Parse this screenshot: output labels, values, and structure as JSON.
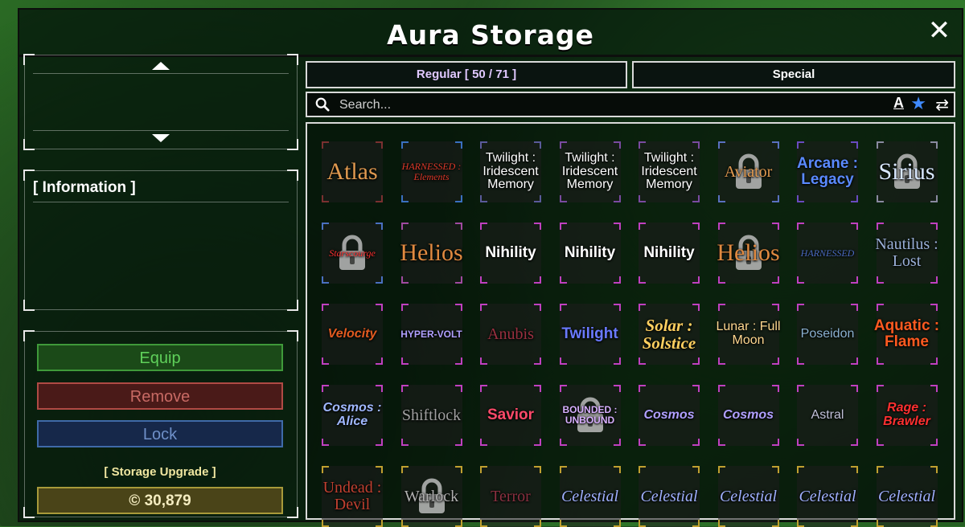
{
  "window": {
    "title": "Aura Storage",
    "close_label": "✕"
  },
  "info_panel": {
    "title": "[ Information ]"
  },
  "actions": {
    "equip": "Equip",
    "remove": "Remove",
    "lock": "Lock",
    "storage_upgrade_label": "[ Storage Upgrade ]",
    "upgrade_cost": "© 30,879"
  },
  "tabs": {
    "regular": "Regular [ 50 / 71 ]",
    "special": "Special"
  },
  "search": {
    "placeholder": "Search..."
  },
  "sort": {
    "alpha_label": "A",
    "favorite_icon": "star-icon",
    "swap_icon": "swap-arrows-icon"
  },
  "auras": [
    {
      "name": "Atlas",
      "locked": false,
      "color": "#e09a50",
      "border": "#7a3030",
      "style": "serif-big"
    },
    {
      "name": "HARNESSED : Elements",
      "locked": false,
      "color": "#e03a2a",
      "border": "#3a70c0",
      "style": "serif-small"
    },
    {
      "name": "Twilight : Iridescent Memory",
      "locked": false,
      "color": "#ffffff",
      "border": "#5a5a9a",
      "style": "sans"
    },
    {
      "name": "Twilight : Iridescent Memory",
      "locked": false,
      "color": "#ffffff",
      "border": "#7a4aa0",
      "style": "sans"
    },
    {
      "name": "Twilight : Iridescent Memory",
      "locked": false,
      "color": "#ffffff",
      "border": "#7a4aa0",
      "style": "sans"
    },
    {
      "name": "Aviator",
      "locked": true,
      "color": "#e09a50",
      "border": "#5a70c0",
      "style": "serif"
    },
    {
      "name": "Arcane : Legacy",
      "locked": false,
      "color": "#5a8aff",
      "border": "#6a4ac0",
      "style": "sans-bold"
    },
    {
      "name": "Sirius",
      "locked": true,
      "color": "#d8e8ff",
      "border": "#8a8aa0",
      "style": "serif-big"
    },
    {
      "name": "Starscourge",
      "locked": true,
      "color": "#ff3030",
      "border": "#4a70c0",
      "style": "serif-small"
    },
    {
      "name": "Helios",
      "locked": false,
      "color": "#e08a40",
      "border": "#a04aa0",
      "style": "serif-big"
    },
    {
      "name": "Nihility",
      "locked": false,
      "color": "#ffffff",
      "border": "#c040c0",
      "style": "sans-bold"
    },
    {
      "name": "Nihility",
      "locked": false,
      "color": "#ffffff",
      "border": "#c040c0",
      "style": "sans-bold"
    },
    {
      "name": "Nihility",
      "locked": false,
      "color": "#ffffff",
      "border": "#c040c0",
      "style": "sans-bold"
    },
    {
      "name": "Helios",
      "locked": true,
      "color": "#e08a40",
      "border": "#c040c0",
      "style": "serif-big"
    },
    {
      "name": "HARNESSED",
      "locked": false,
      "color": "#4a6ac0",
      "border": "#c040c0",
      "style": "serif-small"
    },
    {
      "name": "Nautilus : Lost",
      "locked": false,
      "color": "#9ab0d8",
      "border": "#c040c0",
      "style": "serif"
    },
    {
      "name": "Velocity",
      "locked": false,
      "color": "#e05a20",
      "border": "#c040c0",
      "style": "sans-italic"
    },
    {
      "name": "HYPER-VOLT",
      "locked": false,
      "color": "#b0a0ff",
      "border": "#c040c0",
      "style": "sans-small"
    },
    {
      "name": "Anubis",
      "locked": false,
      "color": "#9a3040",
      "border": "#c040c0",
      "style": "serif"
    },
    {
      "name": "Twilight",
      "locked": false,
      "color": "#6a7aff",
      "border": "#c040c0",
      "style": "sans-bold"
    },
    {
      "name": "Solar : Solstice",
      "locked": false,
      "color": "#ffd060",
      "border": "#c040c0",
      "style": "serif-bold"
    },
    {
      "name": "Lunar : Full Moon",
      "locked": false,
      "color": "#ffd890",
      "border": "#c040c0",
      "style": "sans"
    },
    {
      "name": "Poseidon",
      "locked": false,
      "color": "#8ab0d0",
      "border": "#c040c0",
      "style": "sans"
    },
    {
      "name": "Aquatic : Flame",
      "locked": false,
      "color": "#ff5a20",
      "border": "#c040c0",
      "style": "sans-bold"
    },
    {
      "name": "Cosmos : Alice",
      "locked": false,
      "color": "#a0b8ff",
      "border": "#c040c0",
      "style": "sans-italic"
    },
    {
      "name": "Shiftlock",
      "locked": false,
      "color": "#a0a0a0",
      "border": "#c040c0",
      "style": "serif"
    },
    {
      "name": "Savior",
      "locked": false,
      "color": "#ff4a6a",
      "border": "#c040c0",
      "style": "sans-bold"
    },
    {
      "name": "BOUNDED : UNBOUND",
      "locked": true,
      "color": "#d8b0ff",
      "border": "#c040c0",
      "style": "sans-small"
    },
    {
      "name": "Cosmos",
      "locked": false,
      "color": "#b0a0ff",
      "border": "#c040c0",
      "style": "sans-italic"
    },
    {
      "name": "Cosmos",
      "locked": false,
      "color": "#b0a0ff",
      "border": "#c040c0",
      "style": "sans-italic"
    },
    {
      "name": "Astral",
      "locked": false,
      "color": "#c0c0d8",
      "border": "#c040c0",
      "style": "sans"
    },
    {
      "name": "Rage : Brawler",
      "locked": false,
      "color": "#ff3030",
      "border": "#c040c0",
      "style": "sans-italic"
    },
    {
      "name": "Undead : Devil",
      "locked": false,
      "color": "#c04030",
      "border": "#c0a030",
      "style": "serif"
    },
    {
      "name": "Warlock",
      "locked": true,
      "color": "#b0b0b0",
      "border": "#c0a030",
      "style": "serif"
    },
    {
      "name": "Terror",
      "locked": false,
      "color": "#8a3040",
      "border": "#c0a030",
      "style": "serif"
    },
    {
      "name": "Celestial",
      "locked": false,
      "color": "#a0b0ff",
      "border": "#c0a030",
      "style": "serif-italic"
    },
    {
      "name": "Celestial",
      "locked": false,
      "color": "#a0b0ff",
      "border": "#c0a030",
      "style": "serif-italic"
    },
    {
      "name": "Celestial",
      "locked": false,
      "color": "#a0b0ff",
      "border": "#c0a030",
      "style": "serif-italic"
    },
    {
      "name": "Celestial",
      "locked": false,
      "color": "#a0b0ff",
      "border": "#c0a030",
      "style": "serif-italic"
    },
    {
      "name": "Celestial",
      "locked": false,
      "color": "#a0b0ff",
      "border": "#c0a030",
      "style": "serif-italic"
    }
  ]
}
